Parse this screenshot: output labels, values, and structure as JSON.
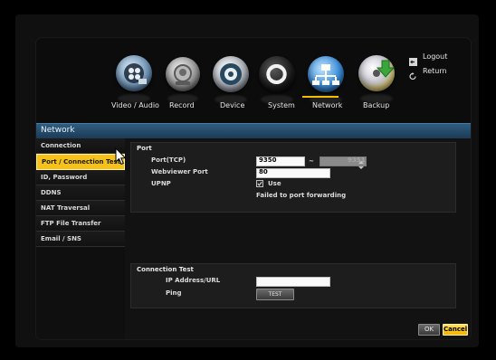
{
  "nav": {
    "items": [
      {
        "label": "Video / Audio",
        "icon": "video-audio-icon"
      },
      {
        "label": "Record",
        "icon": "record-icon"
      },
      {
        "label": "Device",
        "icon": "device-icon"
      },
      {
        "label": "System",
        "icon": "system-icon"
      },
      {
        "label": "Network",
        "icon": "network-icon"
      },
      {
        "label": "Backup",
        "icon": "backup-icon"
      }
    ],
    "active": "Network",
    "active_color": "#f0c000"
  },
  "top_right": {
    "logout_label": "Logout",
    "return_label": "Return"
  },
  "window_title": "Network",
  "sidebar": {
    "items": [
      {
        "label": "Connection"
      },
      {
        "label": "Port / Connection Test"
      },
      {
        "label": "ID, Password"
      },
      {
        "label": "DDNS"
      },
      {
        "label": "NAT Traversal"
      },
      {
        "label": "FTP File Transfer"
      },
      {
        "label": "Email / SNS"
      }
    ],
    "active_index": 1,
    "active_color": "#f6c21a"
  },
  "port": {
    "title": "Port",
    "tcp_label": "Port(TCP)",
    "tcp_from": "9350",
    "tcp_separator": "~",
    "tcp_to": "9351",
    "webviewer_label": "Webviewer Port",
    "webviewer_value": "80",
    "upnp_label": "UPNP",
    "upnp_use_label": "Use",
    "upnp_checked": true,
    "upnp_status": "Failed to port forwarding"
  },
  "connection_test": {
    "title": "Connection Test",
    "ip_label": "IP Address/URL",
    "ip_value": "",
    "ping_label": "Ping",
    "test_button": "TEST"
  },
  "footer": {
    "ok_label": "OK",
    "cancel_label": "Cancel"
  }
}
